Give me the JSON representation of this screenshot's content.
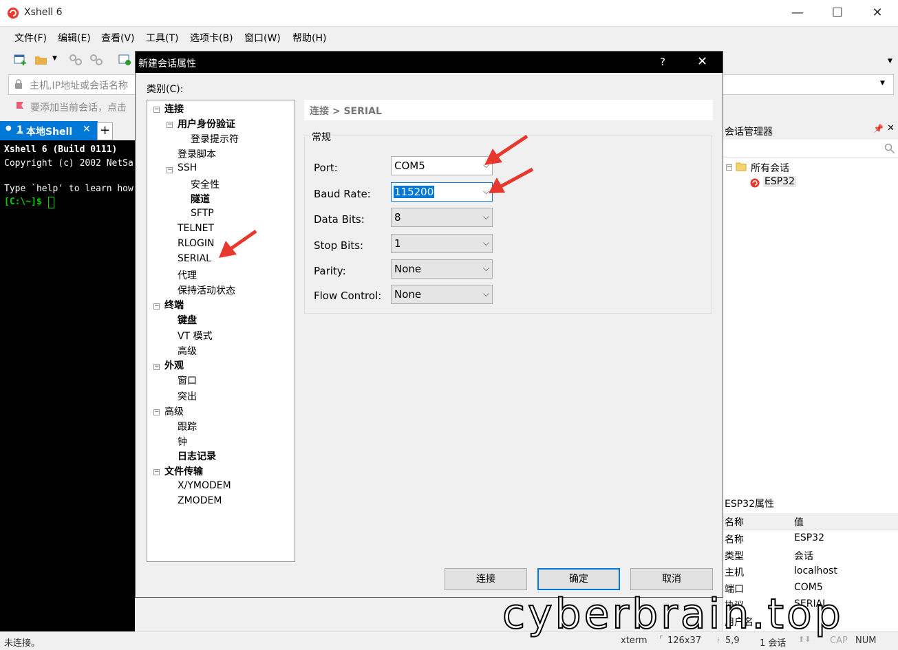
{
  "app": {
    "title": "Xshell 6"
  },
  "menu": [
    "文件(F)",
    "编辑(E)",
    "查看(V)",
    "工具(T)",
    "选项卡(B)",
    "窗口(W)",
    "帮助(H)"
  ],
  "address": {
    "placeholder": "主机,IP地址或会话名称"
  },
  "linkbar": {
    "text": "要添加当前会话，点击"
  },
  "tabs": [
    {
      "index": "1",
      "label": "本地Shell"
    }
  ],
  "terminal": {
    "lines": [
      "Xshell 6 (Build 0111)",
      "Copyright (c) 2002 NetSa",
      "",
      "Type `help' to learn how"
    ],
    "prompt": "[C:\\~]$ "
  },
  "dialog": {
    "title": "新建会话属性",
    "help": "?",
    "category_label": "类别(C):",
    "breadcrumb": "连接 > SERIAL",
    "group_label": "常规",
    "fields": [
      {
        "label": "Port:",
        "value": "COM5"
      },
      {
        "label": "Baud Rate:",
        "value": "115200"
      },
      {
        "label": "Data Bits:",
        "value": "8"
      },
      {
        "label": "Stop Bits:",
        "value": "1"
      },
      {
        "label": "Parity:",
        "value": "None"
      },
      {
        "label": "Flow Control:",
        "value": "None"
      }
    ],
    "buttons": {
      "connect": "连接",
      "ok": "确定",
      "cancel": "取消"
    },
    "tree": [
      "连接",
      "用户身份验证",
      "登录提示符",
      "登录脚本",
      "SSH",
      "安全性",
      "隧道",
      "SFTP",
      "TELNET",
      "RLOGIN",
      "SERIAL",
      "代理",
      "保持活动状态",
      "终端",
      "键盘",
      "VT 模式",
      "高级",
      "外观",
      "窗口",
      "突出",
      "高级",
      "跟踪",
      "钟",
      "日志记录",
      "文件传输",
      "X/YMODEM",
      "ZMODEM"
    ]
  },
  "session_manager": {
    "title": "会话管理器",
    "root": "所有会话",
    "child": "ESP32"
  },
  "properties": {
    "title": "ESP32属性",
    "col_name": "名称",
    "col_value": "值",
    "rows": [
      {
        "name": "名称",
        "value": "ESP32"
      },
      {
        "name": "类型",
        "value": "会话"
      },
      {
        "name": "主机",
        "value": "localhost"
      },
      {
        "name": "端口",
        "value": "COM5"
      },
      {
        "name": "协议",
        "value": "SERIAL"
      },
      {
        "name": "用户名",
        "value": ""
      }
    ]
  },
  "status": {
    "left": "未连接。",
    "term": "xterm",
    "size": "126x37",
    "pos": "5,9",
    "sessions": "1 会话",
    "cap": "CAP",
    "num": "NUM"
  },
  "watermark": "cyberbrain.top",
  "colors": {
    "accent": "#0078d7",
    "arrow": "#e8372c",
    "terminal_bg": "#000000",
    "prompt": "#00d000"
  }
}
